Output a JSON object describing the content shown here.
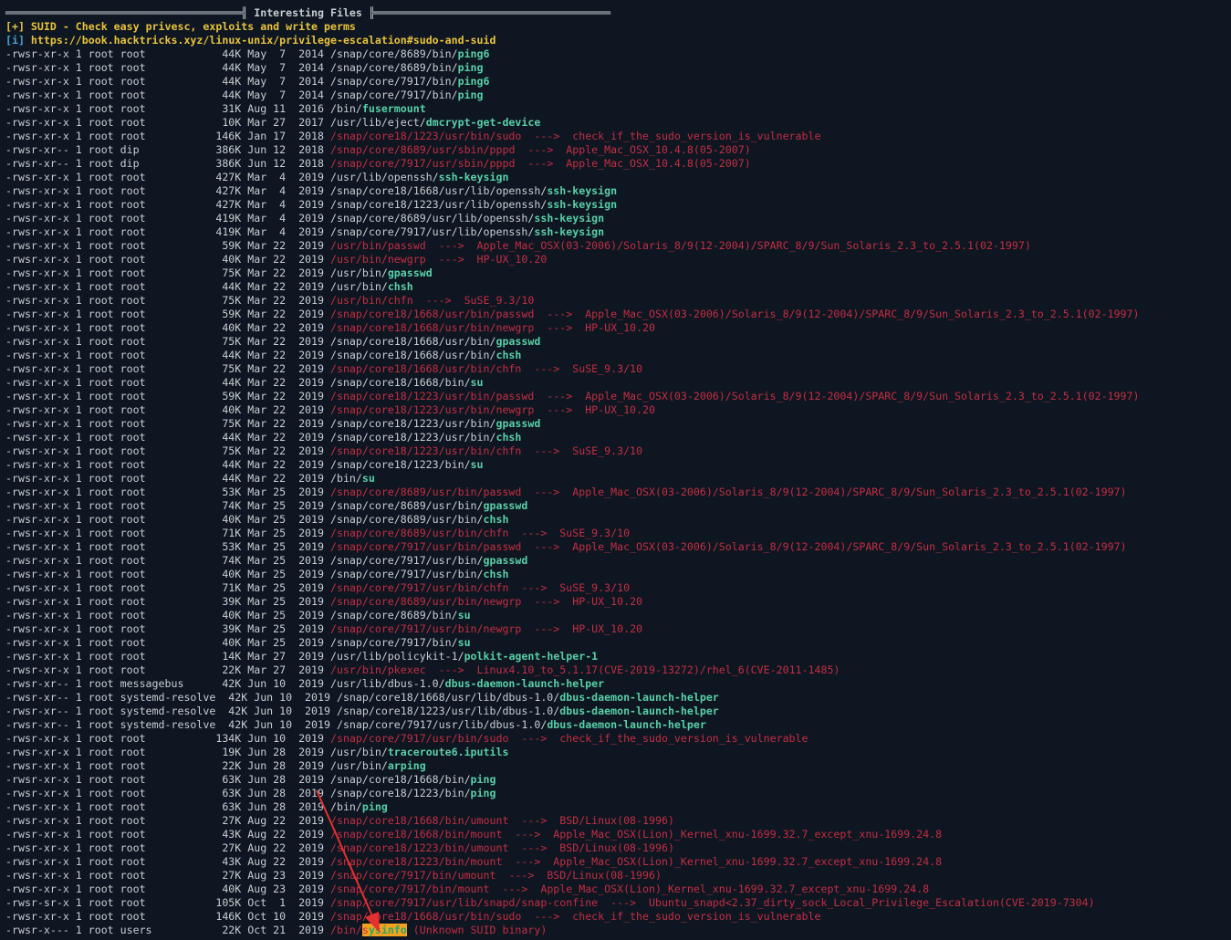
{
  "header": {
    "rule_left": "═════════════════════════════════════╣ ",
    "title": "Interesting Files",
    "rule_right": " ╠═════════════════════════════════════"
  },
  "notes": [
    {
      "prefix": "[+]",
      "text": " SUID - Check easy privesc, exploits and write perms"
    },
    {
      "prefix": "[i]",
      "text": " https://book.hacktricks.xyz/linux-unix/privilege-escalation#sudo-and-suid"
    }
  ],
  "rows": [
    {
      "meta": "-rwsr-xr-x 1 root root            44K May  7  2014 ",
      "dir": "/snap/core/8689/bin/",
      "bin": "ping6",
      "vuln": false,
      "exploit": ""
    },
    {
      "meta": "-rwsr-xr-x 1 root root            44K May  7  2014 ",
      "dir": "/snap/core/8689/bin/",
      "bin": "ping",
      "vuln": false,
      "exploit": ""
    },
    {
      "meta": "-rwsr-xr-x 1 root root            44K May  7  2014 ",
      "dir": "/snap/core/7917/bin/",
      "bin": "ping6",
      "vuln": false,
      "exploit": ""
    },
    {
      "meta": "-rwsr-xr-x 1 root root            44K May  7  2014 ",
      "dir": "/snap/core/7917/bin/",
      "bin": "ping",
      "vuln": false,
      "exploit": ""
    },
    {
      "meta": "-rwsr-xr-x 1 root root            31K Aug 11  2016 ",
      "dir": "/bin/",
      "bin": "fusermount",
      "vuln": false,
      "exploit": ""
    },
    {
      "meta": "-rwsr-xr-x 1 root root            10K Mar 27  2017 ",
      "dir": "/usr/lib/eject/",
      "bin": "dmcrypt-get-device",
      "vuln": false,
      "exploit": ""
    },
    {
      "meta": "-rwsr-xr-x 1 root root           146K Jan 17  2018 ",
      "dir": "/snap/core18/1223/usr/bin/",
      "bin": "sudo",
      "vuln": true,
      "exploit": "  --->  check_if_the_sudo_version_is_vulnerable"
    },
    {
      "meta": "-rwsr-xr-- 1 root dip            386K Jun 12  2018 ",
      "dir": "/snap/core/8689/usr/sbin/",
      "bin": "pppd",
      "vuln": true,
      "exploit": "  --->  Apple_Mac_OSX_10.4.8(05-2007)"
    },
    {
      "meta": "-rwsr-xr-- 1 root dip            386K Jun 12  2018 ",
      "dir": "/snap/core/7917/usr/sbin/",
      "bin": "pppd",
      "vuln": true,
      "exploit": "  --->  Apple_Mac_OSX_10.4.8(05-2007)"
    },
    {
      "meta": "-rwsr-xr-x 1 root root           427K Mar  4  2019 ",
      "dir": "/usr/lib/openssh/",
      "bin": "ssh-keysign",
      "vuln": false,
      "exploit": ""
    },
    {
      "meta": "-rwsr-xr-x 1 root root           427K Mar  4  2019 ",
      "dir": "/snap/core18/1668/usr/lib/openssh/",
      "bin": "ssh-keysign",
      "vuln": false,
      "exploit": ""
    },
    {
      "meta": "-rwsr-xr-x 1 root root           427K Mar  4  2019 ",
      "dir": "/snap/core18/1223/usr/lib/openssh/",
      "bin": "ssh-keysign",
      "vuln": false,
      "exploit": ""
    },
    {
      "meta": "-rwsr-xr-x 1 root root           419K Mar  4  2019 ",
      "dir": "/snap/core/8689/usr/lib/openssh/",
      "bin": "ssh-keysign",
      "vuln": false,
      "exploit": ""
    },
    {
      "meta": "-rwsr-xr-x 1 root root           419K Mar  4  2019 ",
      "dir": "/snap/core/7917/usr/lib/openssh/",
      "bin": "ssh-keysign",
      "vuln": false,
      "exploit": ""
    },
    {
      "meta": "-rwsr-xr-x 1 root root            59K Mar 22  2019 ",
      "dir": "/usr/bin/",
      "bin": "passwd",
      "vuln": true,
      "exploit": "  --->  Apple_Mac_OSX(03-2006)/Solaris_8/9(12-2004)/SPARC_8/9/Sun_Solaris_2.3_to_2.5.1(02-1997)"
    },
    {
      "meta": "-rwsr-xr-x 1 root root            40K Mar 22  2019 ",
      "dir": "/usr/bin/",
      "bin": "newgrp",
      "vuln": true,
      "exploit": "  --->  HP-UX_10.20"
    },
    {
      "meta": "-rwsr-xr-x 1 root root            75K Mar 22  2019 ",
      "dir": "/usr/bin/",
      "bin": "gpasswd",
      "vuln": false,
      "exploit": ""
    },
    {
      "meta": "-rwsr-xr-x 1 root root            44K Mar 22  2019 ",
      "dir": "/usr/bin/",
      "bin": "chsh",
      "vuln": false,
      "exploit": ""
    },
    {
      "meta": "-rwsr-xr-x 1 root root            75K Mar 22  2019 ",
      "dir": "/usr/bin/",
      "bin": "chfn",
      "vuln": true,
      "exploit": "  --->  SuSE_9.3/10"
    },
    {
      "meta": "-rwsr-xr-x 1 root root            59K Mar 22  2019 ",
      "dir": "/snap/core18/1668/usr/bin/",
      "bin": "passwd",
      "vuln": true,
      "exploit": "  --->  Apple_Mac_OSX(03-2006)/Solaris_8/9(12-2004)/SPARC_8/9/Sun_Solaris_2.3_to_2.5.1(02-1997)"
    },
    {
      "meta": "-rwsr-xr-x 1 root root            40K Mar 22  2019 ",
      "dir": "/snap/core18/1668/usr/bin/",
      "bin": "newgrp",
      "vuln": true,
      "exploit": "  --->  HP-UX_10.20"
    },
    {
      "meta": "-rwsr-xr-x 1 root root            75K Mar 22  2019 ",
      "dir": "/snap/core18/1668/usr/bin/",
      "bin": "gpasswd",
      "vuln": false,
      "exploit": ""
    },
    {
      "meta": "-rwsr-xr-x 1 root root            44K Mar 22  2019 ",
      "dir": "/snap/core18/1668/usr/bin/",
      "bin": "chsh",
      "vuln": false,
      "exploit": ""
    },
    {
      "meta": "-rwsr-xr-x 1 root root            75K Mar 22  2019 ",
      "dir": "/snap/core18/1668/usr/bin/",
      "bin": "chfn",
      "vuln": true,
      "exploit": "  --->  SuSE_9.3/10"
    },
    {
      "meta": "-rwsr-xr-x 1 root root            44K Mar 22  2019 ",
      "dir": "/snap/core18/1668/bin/",
      "bin": "su",
      "vuln": false,
      "exploit": ""
    },
    {
      "meta": "-rwsr-xr-x 1 root root            59K Mar 22  2019 ",
      "dir": "/snap/core18/1223/usr/bin/",
      "bin": "passwd",
      "vuln": true,
      "exploit": "  --->  Apple_Mac_OSX(03-2006)/Solaris_8/9(12-2004)/SPARC_8/9/Sun_Solaris_2.3_to_2.5.1(02-1997)"
    },
    {
      "meta": "-rwsr-xr-x 1 root root            40K Mar 22  2019 ",
      "dir": "/snap/core18/1223/usr/bin/",
      "bin": "newgrp",
      "vuln": true,
      "exploit": "  --->  HP-UX_10.20"
    },
    {
      "meta": "-rwsr-xr-x 1 root root            75K Mar 22  2019 ",
      "dir": "/snap/core18/1223/usr/bin/",
      "bin": "gpasswd",
      "vuln": false,
      "exploit": ""
    },
    {
      "meta": "-rwsr-xr-x 1 root root            44K Mar 22  2019 ",
      "dir": "/snap/core18/1223/usr/bin/",
      "bin": "chsh",
      "vuln": false,
      "exploit": ""
    },
    {
      "meta": "-rwsr-xr-x 1 root root            75K Mar 22  2019 ",
      "dir": "/snap/core18/1223/usr/bin/",
      "bin": "chfn",
      "vuln": true,
      "exploit": "  --->  SuSE_9.3/10"
    },
    {
      "meta": "-rwsr-xr-x 1 root root            44K Mar 22  2019 ",
      "dir": "/snap/core18/1223/bin/",
      "bin": "su",
      "vuln": false,
      "exploit": ""
    },
    {
      "meta": "-rwsr-xr-x 1 root root            44K Mar 22  2019 ",
      "dir": "/bin/",
      "bin": "su",
      "vuln": false,
      "exploit": ""
    },
    {
      "meta": "-rwsr-xr-x 1 root root            53K Mar 25  2019 ",
      "dir": "/snap/core/8689/usr/bin/",
      "bin": "passwd",
      "vuln": true,
      "exploit": "  --->  Apple_Mac_OSX(03-2006)/Solaris_8/9(12-2004)/SPARC_8/9/Sun_Solaris_2.3_to_2.5.1(02-1997)"
    },
    {
      "meta": "-rwsr-xr-x 1 root root            74K Mar 25  2019 ",
      "dir": "/snap/core/8689/usr/bin/",
      "bin": "gpasswd",
      "vuln": false,
      "exploit": ""
    },
    {
      "meta": "-rwsr-xr-x 1 root root            40K Mar 25  2019 ",
      "dir": "/snap/core/8689/usr/bin/",
      "bin": "chsh",
      "vuln": false,
      "exploit": ""
    },
    {
      "meta": "-rwsr-xr-x 1 root root            71K Mar 25  2019 ",
      "dir": "/snap/core/8689/usr/bin/",
      "bin": "chfn",
      "vuln": true,
      "exploit": "  --->  SuSE_9.3/10"
    },
    {
      "meta": "-rwsr-xr-x 1 root root            53K Mar 25  2019 ",
      "dir": "/snap/core/7917/usr/bin/",
      "bin": "passwd",
      "vuln": true,
      "exploit": "  --->  Apple_Mac_OSX(03-2006)/Solaris_8/9(12-2004)/SPARC_8/9/Sun_Solaris_2.3_to_2.5.1(02-1997)"
    },
    {
      "meta": "-rwsr-xr-x 1 root root            74K Mar 25  2019 ",
      "dir": "/snap/core/7917/usr/bin/",
      "bin": "gpasswd",
      "vuln": false,
      "exploit": ""
    },
    {
      "meta": "-rwsr-xr-x 1 root root            40K Mar 25  2019 ",
      "dir": "/snap/core/7917/usr/bin/",
      "bin": "chsh",
      "vuln": false,
      "exploit": ""
    },
    {
      "meta": "-rwsr-xr-x 1 root root            71K Mar 25  2019 ",
      "dir": "/snap/core/7917/usr/bin/",
      "bin": "chfn",
      "vuln": true,
      "exploit": "  --->  SuSE_9.3/10"
    },
    {
      "meta": "-rwsr-xr-x 1 root root            39K Mar 25  2019 ",
      "dir": "/snap/core/8689/usr/bin/",
      "bin": "newgrp",
      "vuln": true,
      "exploit": "  --->  HP-UX_10.20"
    },
    {
      "meta": "-rwsr-xr-x 1 root root            40K Mar 25  2019 ",
      "dir": "/snap/core/8689/bin/",
      "bin": "su",
      "vuln": false,
      "exploit": ""
    },
    {
      "meta": "-rwsr-xr-x 1 root root            39K Mar 25  2019 ",
      "dir": "/snap/core/7917/usr/bin/",
      "bin": "newgrp",
      "vuln": true,
      "exploit": "  --->  HP-UX_10.20"
    },
    {
      "meta": "-rwsr-xr-x 1 root root            40K Mar 25  2019 ",
      "dir": "/snap/core/7917/bin/",
      "bin": "su",
      "vuln": false,
      "exploit": ""
    },
    {
      "meta": "-rwsr-xr-x 1 root root            14K Mar 27  2019 ",
      "dir": "/usr/lib/policykit-1/",
      "bin": "polkit-agent-helper-1",
      "vuln": false,
      "exploit": ""
    },
    {
      "meta": "-rwsr-xr-x 1 root root            22K Mar 27  2019 ",
      "dir": "/usr/bin/",
      "bin": "pkexec",
      "vuln": true,
      "exploit": "  --->  Linux4.10_to_5.1.17(CVE-2019-13272)/rhel_6(CVE-2011-1485)"
    },
    {
      "meta": "-rwsr-xr-- 1 root messagebus      42K Jun 10  2019 ",
      "dir": "/usr/lib/dbus-1.0/",
      "bin": "dbus-daemon-launch-helper",
      "vuln": false,
      "exploit": ""
    },
    {
      "meta": "-rwsr-xr-- 1 root systemd-resolve  42K Jun 10  2019 ",
      "dir": "/snap/core18/1668/usr/lib/dbus-1.0/",
      "bin": "dbus-daemon-launch-helper",
      "vuln": false,
      "exploit": ""
    },
    {
      "meta": "-rwsr-xr-- 1 root systemd-resolve  42K Jun 10  2019 ",
      "dir": "/snap/core18/1223/usr/lib/dbus-1.0/",
      "bin": "dbus-daemon-launch-helper",
      "vuln": false,
      "exploit": ""
    },
    {
      "meta": "-rwsr-xr-- 1 root systemd-resolve  42K Jun 10  2019 ",
      "dir": "/snap/core/7917/usr/lib/dbus-1.0/",
      "bin": "dbus-daemon-launch-helper",
      "vuln": false,
      "exploit": ""
    },
    {
      "meta": "-rwsr-xr-x 1 root root           134K Jun 10  2019 ",
      "dir": "/snap/core/7917/usr/bin/",
      "bin": "sudo",
      "vuln": true,
      "exploit": "  --->  check_if_the_sudo_version_is_vulnerable"
    },
    {
      "meta": "-rwsr-xr-x 1 root root            19K Jun 28  2019 ",
      "dir": "/usr/bin/",
      "bin": "traceroute6.iputils",
      "vuln": false,
      "exploit": ""
    },
    {
      "meta": "-rwsr-xr-x 1 root root            22K Jun 28  2019 ",
      "dir": "/usr/bin/",
      "bin": "arping",
      "vuln": false,
      "exploit": ""
    },
    {
      "meta": "-rwsr-xr-x 1 root root            63K Jun 28  2019 ",
      "dir": "/snap/core18/1668/bin/",
      "bin": "ping",
      "vuln": false,
      "exploit": ""
    },
    {
      "meta": "-rwsr-xr-x 1 root root            63K Jun 28  2019 ",
      "dir": "/snap/core18/1223/bin/",
      "bin": "ping",
      "vuln": false,
      "exploit": ""
    },
    {
      "meta": "-rwsr-xr-x 1 root root            63K Jun 28  2019 ",
      "dir": "/bin/",
      "bin": "ping",
      "vuln": false,
      "exploit": ""
    },
    {
      "meta": "-rwsr-xr-x 1 root root            27K Aug 22  2019 ",
      "dir": "/snap/core18/1668/bin/",
      "bin": "umount",
      "vuln": true,
      "exploit": "  --->  BSD/Linux(08-1996)"
    },
    {
      "meta": "-rwsr-xr-x 1 root root            43K Aug 22  2019 ",
      "dir": "/snap/core18/1668/bin/",
      "bin": "mount",
      "vuln": true,
      "exploit": "  --->  Apple_Mac_OSX(Lion)_Kernel_xnu-1699.32.7_except_xnu-1699.24.8"
    },
    {
      "meta": "-rwsr-xr-x 1 root root            27K Aug 22  2019 ",
      "dir": "/snap/core18/1223/bin/",
      "bin": "umount",
      "vuln": true,
      "exploit": "  --->  BSD/Linux(08-1996)"
    },
    {
      "meta": "-rwsr-xr-x 1 root root            43K Aug 22  2019 ",
      "dir": "/snap/core18/1223/bin/",
      "bin": "mount",
      "vuln": true,
      "exploit": "  --->  Apple_Mac_OSX(Lion)_Kernel_xnu-1699.32.7_except_xnu-1699.24.8"
    },
    {
      "meta": "-rwsr-xr-x 1 root root            27K Aug 23  2019 ",
      "dir": "/snap/core/7917/bin/",
      "bin": "umount",
      "vuln": true,
      "exploit": "  --->  BSD/Linux(08-1996)"
    },
    {
      "meta": "-rwsr-xr-x 1 root root            40K Aug 23  2019 ",
      "dir": "/snap/core/7917/bin/",
      "bin": "mount",
      "vuln": true,
      "exploit": "  --->  Apple_Mac_OSX(Lion)_Kernel_xnu-1699.32.7_except_xnu-1699.24.8"
    },
    {
      "meta": "-rwsr-sr-x 1 root root           105K Oct  1  2019 ",
      "dir": "/snap/core/7917/usr/lib/snapd/",
      "bin": "snap-confine",
      "vuln": true,
      "exploit": "  --->  Ubuntu_snapd<2.37_dirty_sock_Local_Privilege_Escalation(CVE-2019-7304)"
    },
    {
      "meta": "-rwsr-xr-x 1 root root           146K Oct 10  2019 ",
      "dir": "/snap/core18/1668/usr/bin/",
      "bin": "sudo",
      "vuln": true,
      "exploit": "  --->  check_if_the_sudo_version_is_vulnerable"
    }
  ],
  "last_row": {
    "meta": "-rwsr-x--- 1 root users           22K Oct 21  2019 ",
    "dir": "/bin/",
    "bin_first": "s",
    "bin_rest": "ysinfo",
    "note": " (Unknown SUID binary)"
  },
  "colors": {
    "background": "#0e1621",
    "default_text": "#c8cdd2",
    "binary": "#58cfa8",
    "vulnerable": "#c22e44",
    "warning": "#e8c33b",
    "highlight": "#f5a21d",
    "annotation_arrow": "#e53030"
  }
}
